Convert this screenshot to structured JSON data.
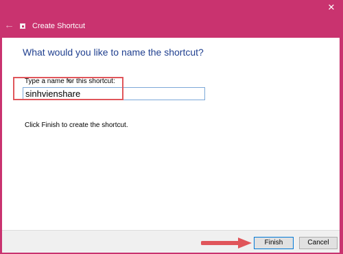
{
  "window": {
    "title": "Create Shortcut",
    "close_glyph": "✕",
    "back_glyph": "←",
    "accent_color": "#c9336f"
  },
  "page": {
    "heading": "What would you like to name the shortcut?",
    "name_label": "Type a name for this shortcut:",
    "name_value": "sinhvienshare",
    "instruction": "Click Finish to create the shortcut."
  },
  "footer": {
    "finish_label": "Finish",
    "cancel_label": "Cancel"
  },
  "annotation": {
    "highlight_color": "#e0555a",
    "arrow_color": "#e0555a"
  }
}
